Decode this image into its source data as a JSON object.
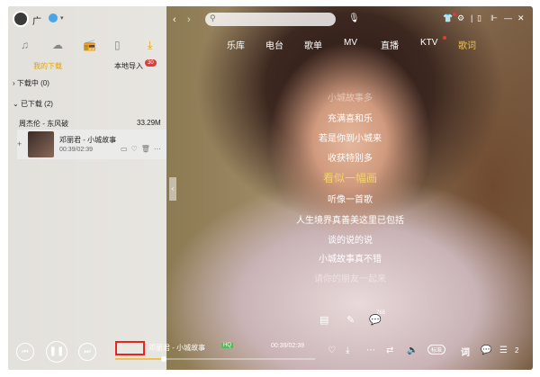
{
  "user": {
    "name": "广",
    "vip_icon": "vip-diamond-icon"
  },
  "sidebar": {
    "icons": [
      "music-note-icon",
      "cloud-icon",
      "radio-icon",
      "device-icon",
      "download-icon"
    ],
    "subtabs": [
      {
        "label": "我的下载",
        "active": true
      },
      {
        "label": "本地导入",
        "active": false,
        "badge": "30"
      }
    ],
    "groups": [
      {
        "label": "下载中",
        "count": "(0)"
      },
      {
        "label": "已下载",
        "count": "(2)"
      }
    ],
    "songs": [
      {
        "title": "周杰伦 - 东风破",
        "size": "33.29M"
      }
    ],
    "now_playing": {
      "title": "邓丽君 - 小城故事",
      "time": "00:39/02:39"
    }
  },
  "nav": {
    "tabs": [
      {
        "label": "乐库",
        "active": false
      },
      {
        "label": "电台",
        "active": false
      },
      {
        "label": "歌单",
        "active": false
      },
      {
        "label": "MV",
        "active": false
      },
      {
        "label": "直播",
        "active": false
      },
      {
        "label": "KTV",
        "active": false
      },
      {
        "label": "歌词",
        "active": true
      }
    ]
  },
  "lyrics": {
    "lines": [
      {
        "text": "小城故事多",
        "state": "faded"
      },
      {
        "text": "充满喜和乐",
        "state": "normal"
      },
      {
        "text": "若是你到小城来",
        "state": "normal"
      },
      {
        "text": "收获特别多",
        "state": "normal"
      },
      {
        "text": "看似一幅画",
        "state": "current"
      },
      {
        "text": "听像一首歌",
        "state": "normal"
      },
      {
        "text": "人生境界真善美这里已包括",
        "state": "normal"
      },
      {
        "text": "谈的说的说",
        "state": "normal"
      },
      {
        "text": "小城故事真不错",
        "state": "normal"
      },
      {
        "text": "请你的朋友一起来",
        "state": "faded"
      }
    ],
    "comment_count": "765"
  },
  "player": {
    "title": "邓丽君 - 小城故事",
    "quality_badge": "HQ",
    "time": "00:39/02:39",
    "progress": 0.245,
    "sound_quality": "标准",
    "lyric_label": "词",
    "queue_count": "2"
  },
  "colors": {
    "accent": "#f0c24b",
    "badge_red": "#e23b3b",
    "active_tab": "#e1a300"
  }
}
